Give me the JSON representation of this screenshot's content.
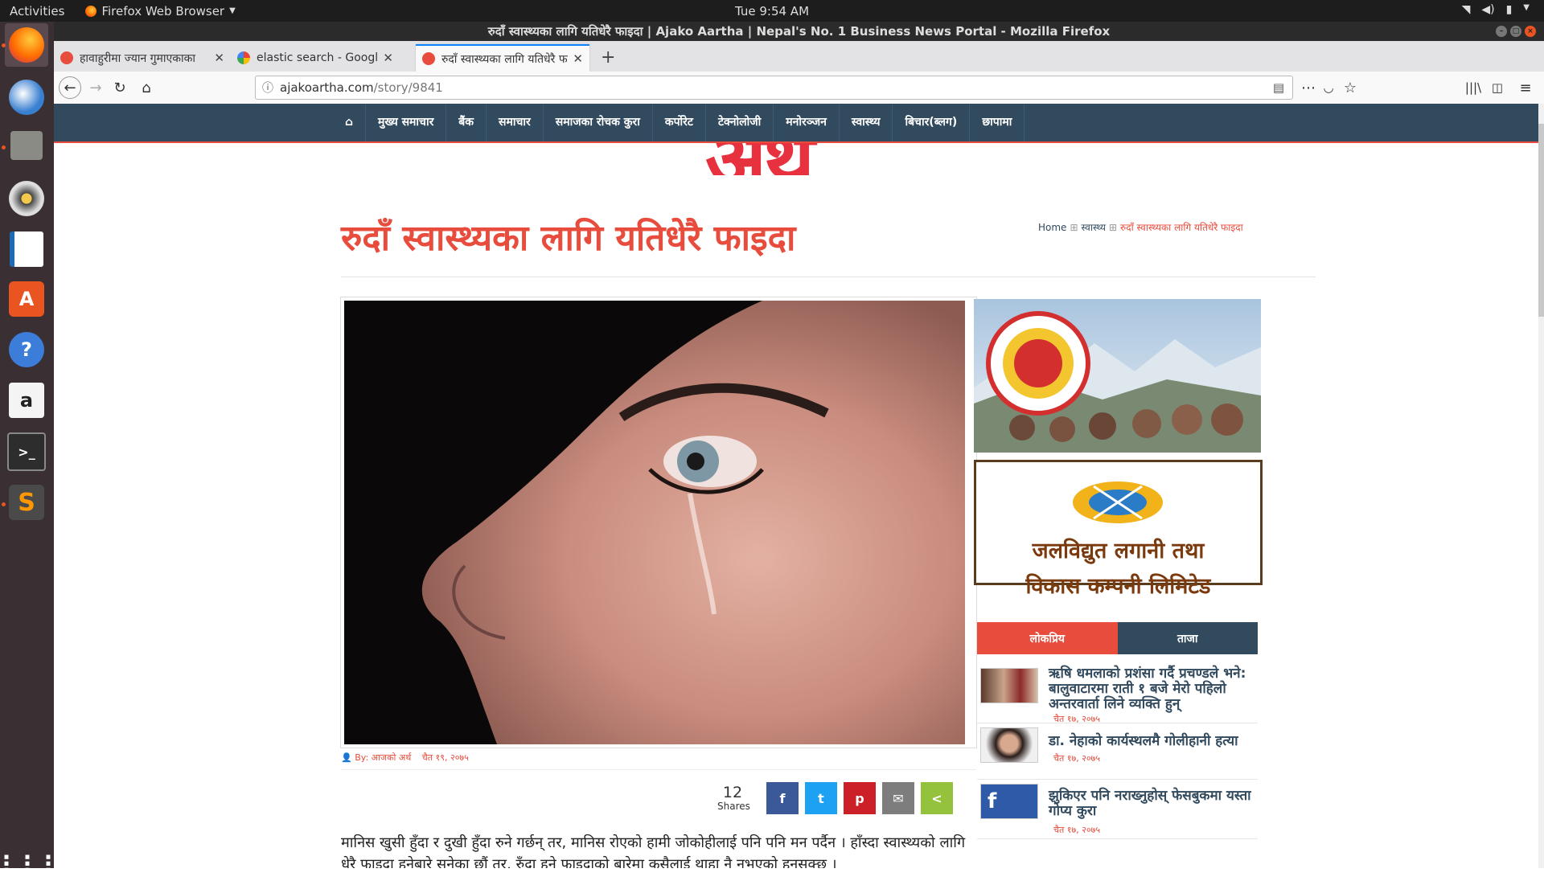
{
  "system": {
    "activities": "Activities",
    "app_menu": "Firefox Web Browser",
    "clock": "Tue  9:54 AM"
  },
  "window": {
    "title": "रुदाँ स्वास्थ्यका लागि यतिधेरै फाइदा | Ajako Aartha | Nepal's No. 1 Business News Portal - Mozilla Firefox"
  },
  "tabs": [
    {
      "label": "हावाहुरीमा ज्यान गुमाएकाका"
    },
    {
      "label": "elastic search - Google Se"
    },
    {
      "label": "रुदाँ स्वास्थ्यका लागि यतिधेरै फाइदा"
    }
  ],
  "url": {
    "domain": "ajakoartha.com",
    "path": "/story/9841"
  },
  "site_nav": {
    "items": [
      "मुख्य समाचार",
      "बैंक",
      "समाचार",
      "समाजका रोचक कुरा",
      "कर्पोरेट",
      "टेक्नोलोजी",
      "मनोरञ्जन",
      "स्वास्थ्य",
      "बिचार(ब्लग)",
      "छापामा"
    ]
  },
  "logo_text": "अर्थ",
  "article": {
    "headline": "रुदाँ स्वास्थ्यका लागि यतिधेरै फाइदा",
    "breadcrumb": {
      "home": "Home",
      "section": "स्वास्थ्य",
      "current": "रुदाँ स्वास्थ्यका लागि यतिधेरै फाइदा"
    },
    "author": "By: आजको अर्थ",
    "date": "चैत १९, २०७५",
    "share_count": "12",
    "share_label": "Shares",
    "body": "मानिस खुसी हुँदा र दुखी हुँदा रुने गर्छन् तर, मानिस रोएको हामी जोकोहीलाई पनि पनि मन पर्दैन । हाँस्दा स्वास्थ्यको लागि धेरै फाइदा हुनेबारे सुनेका छौं  तर, रुँदा हुने फाइदाको बारेमा कसैलाई थाहा नै नभएको हुनसक्छ ।"
  },
  "share_buttons": [
    {
      "name": "facebook",
      "glyph": "f",
      "color": "#3b5998"
    },
    {
      "name": "twitter",
      "glyph": "t",
      "color": "#1da1f2"
    },
    {
      "name": "pinterest",
      "glyph": "p",
      "color": "#cb2027"
    },
    {
      "name": "email",
      "glyph": "✉",
      "color": "#7d7d7d"
    },
    {
      "name": "share",
      "glyph": "<",
      "color": "#95c23d"
    }
  ],
  "sidebar": {
    "ad2_line1": "जलविद्युत लगानी तथा",
    "ad2_line2": "विकास कम्पनी लिमिटेड",
    "tab_popular": "लोकप्रिय",
    "tab_latest": "ताजा",
    "news": [
      {
        "title": "ऋषि धमलाको प्रशंसा गर्दै प्रचण्डले भने: बालुवाटारमा राती १ बजे मेरो पहिलो अन्तरवार्ता लिने व्यक्ति हुन्",
        "date": "चैत १७, २०७५"
      },
      {
        "title": "डा. नेहाको कार्यस्थलमै गोलीहानी हत्या",
        "date": "चैत १७, २०७५"
      },
      {
        "title": "झुकिएर पनि नराख्नुहोस् फेसबुकमा यस्ता गोप्य कुरा",
        "date": "चैत १७, २०७५"
      }
    ]
  },
  "colors": {
    "nav_bg": "#324a5e",
    "accent_red": "#e74c3c"
  }
}
